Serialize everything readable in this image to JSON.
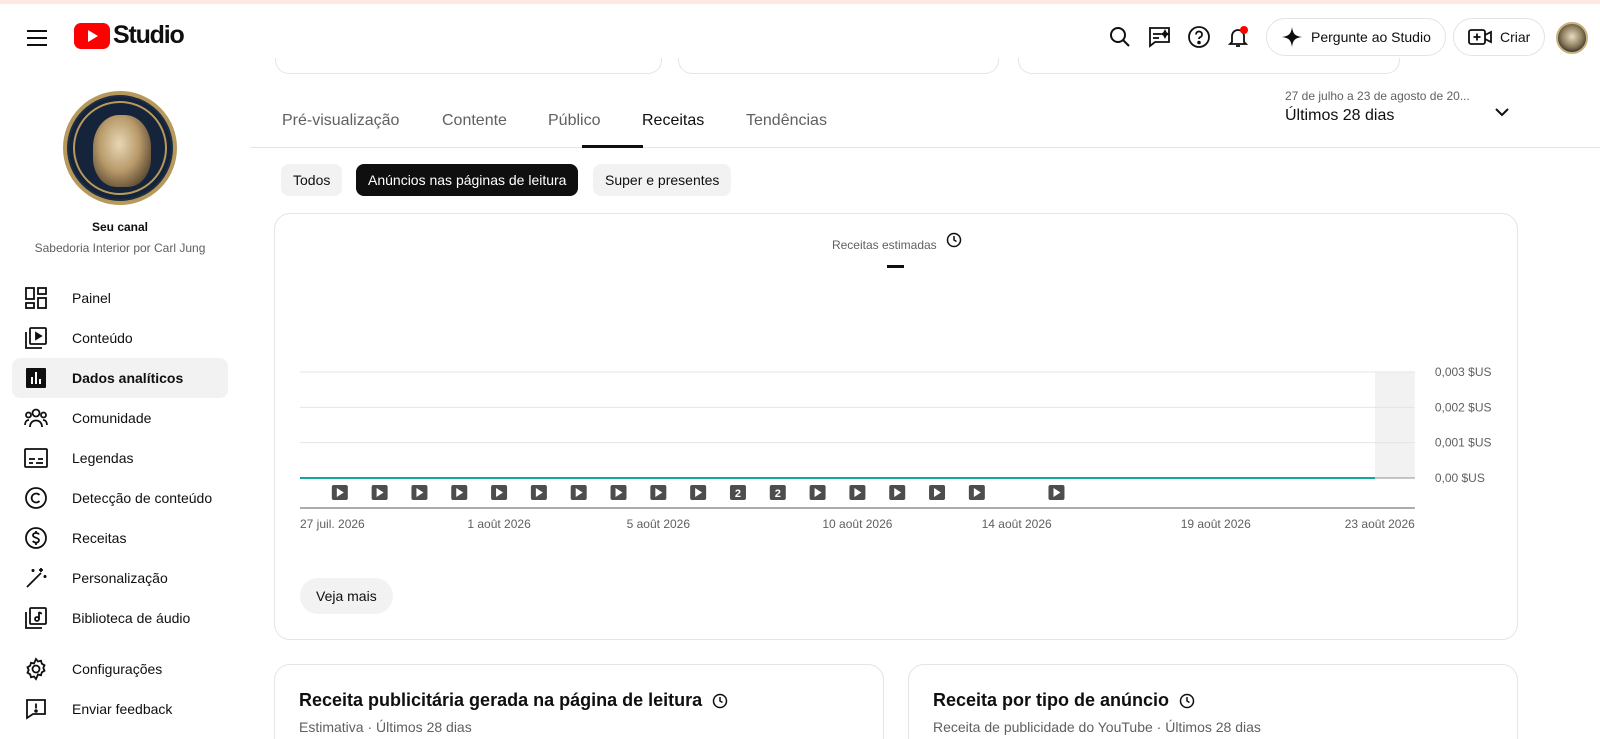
{
  "header": {
    "logo_text": "Studio",
    "ask_studio_label": "Pergunte ao Studio",
    "create_label": "Criar"
  },
  "sidebar": {
    "channel_label": "Seu canal",
    "channel_name": "Sabedoria Interior por Carl Jung",
    "items": [
      {
        "label": "Painel",
        "icon": "dashboard-icon"
      },
      {
        "label": "Conteúdo",
        "icon": "content-icon"
      },
      {
        "label": "Dados analíticos",
        "icon": "analytics-icon",
        "active": true
      },
      {
        "label": "Comunidade",
        "icon": "community-icon"
      },
      {
        "label": "Legendas",
        "icon": "subtitles-icon"
      },
      {
        "label": "Detecção de conteúdo",
        "icon": "copyright-icon"
      },
      {
        "label": "Receitas",
        "icon": "monetization-icon"
      },
      {
        "label": "Personalização",
        "icon": "customization-icon"
      },
      {
        "label": "Biblioteca de áudio",
        "icon": "audio-library-icon"
      },
      {
        "label": "Configurações",
        "icon": "settings-icon"
      },
      {
        "label": "Enviar feedback",
        "icon": "feedback-icon"
      }
    ]
  },
  "tabs": [
    {
      "label": "Pré-visualização"
    },
    {
      "label": "Contente"
    },
    {
      "label": "Público"
    },
    {
      "label": "Receitas",
      "active": true
    },
    {
      "label": "Tendências"
    }
  ],
  "date_range": {
    "sub": "27 de julho a 23 de agosto de 20...",
    "main": "Últimos 28 dias"
  },
  "chips": [
    {
      "label": "Todos"
    },
    {
      "label": "Anúncios nas páginas de leitura",
      "active": true
    },
    {
      "label": "Super e presentes"
    }
  ],
  "chart_card": {
    "metric_label": "Receitas estimadas",
    "see_more_label": "Veja mais"
  },
  "chart_data": {
    "type": "line",
    "y_ticks": [
      "0,003 $US",
      "0,002 $US",
      "0,001 $US",
      "0,00 $US"
    ],
    "ylim": [
      0,
      0.003
    ],
    "x_tick_labels": [
      "27 juil. 2026",
      "1 août 2026",
      "5 août 2026",
      "10 août 2026",
      "14 août 2026",
      "19 août 2026",
      "23 août 2026"
    ],
    "x_tick_days": [
      0,
      5,
      9,
      14,
      18,
      23,
      27
    ],
    "days": 28,
    "series": [
      {
        "values": [
          0,
          0,
          0,
          0,
          0,
          0,
          0,
          0,
          0,
          0,
          0,
          0,
          0,
          0,
          0,
          0,
          0,
          0,
          0,
          0,
          0,
          0,
          0,
          0,
          0,
          0,
          0,
          0
        ],
        "color": "#12a89d"
      }
    ],
    "upload_markers": [
      {
        "day": 1,
        "label": ""
      },
      {
        "day": 2,
        "label": ""
      },
      {
        "day": 3,
        "label": ""
      },
      {
        "day": 4,
        "label": ""
      },
      {
        "day": 5,
        "label": ""
      },
      {
        "day": 6,
        "label": ""
      },
      {
        "day": 7,
        "label": ""
      },
      {
        "day": 8,
        "label": ""
      },
      {
        "day": 9,
        "label": ""
      },
      {
        "day": 10,
        "label": ""
      },
      {
        "day": 11,
        "label": "2"
      },
      {
        "day": 12,
        "label": "2"
      },
      {
        "day": 13,
        "label": ""
      },
      {
        "day": 14,
        "label": ""
      },
      {
        "day": 15,
        "label": ""
      },
      {
        "day": 16,
        "label": ""
      },
      {
        "day": 17,
        "label": ""
      },
      {
        "day": 19,
        "label": ""
      }
    ],
    "shaded_last_day": true,
    "grid": true
  },
  "bottom_cards": [
    {
      "title": "Receita publicitária gerada na página de leitura",
      "subtitle": "Estimativa · Últimos 28 dias"
    },
    {
      "title": "Receita por tipo de anúncio",
      "subtitle": "Receita de publicidade do YouTube · Últimos 28 dias"
    }
  ]
}
